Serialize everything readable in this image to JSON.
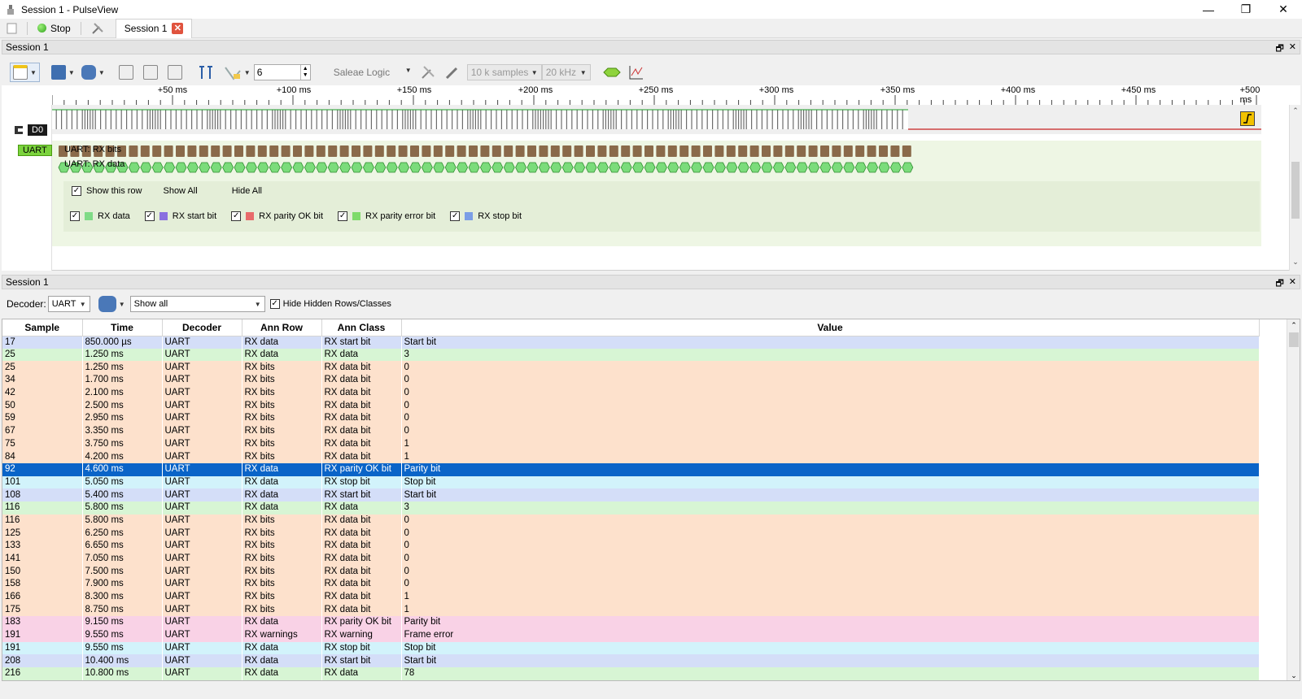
{
  "window": {
    "title": "Session 1 - PulseView",
    "minimize": "—",
    "restore": "❐",
    "close": "✕"
  },
  "tabbar": {
    "stop_label": "Stop",
    "tab_label": "Session 1",
    "tab_close": "✕"
  },
  "panel1": {
    "title": "Session 1",
    "float": "🗗",
    "close": "✕"
  },
  "toolbar1": {
    "samplerate_spin": "6",
    "device": "Saleae Logic",
    "samples": "10 k samples",
    "rate": "20 kHz"
  },
  "ruler": {
    "labels": [
      "+50 ms",
      "+100 ms",
      "+150 ms",
      "+200 ms",
      "+250 ms",
      "+300 ms",
      "+350 ms",
      "+400 ms",
      "+450 ms",
      "+500 ms"
    ]
  },
  "signals": {
    "d0": "D0",
    "uart": "UART",
    "row_bits": "UART: RX bits",
    "row_data": "UART: RX data"
  },
  "row_options": {
    "show_this_row": "Show this row",
    "show_all": "Show All",
    "hide_all": "Hide All",
    "classes": [
      {
        "label": "RX data",
        "color": "#7fdb86"
      },
      {
        "label": "RX start bit",
        "color": "#8a6fe0"
      },
      {
        "label": "RX parity OK bit",
        "color": "#e86b6b"
      },
      {
        "label": "RX parity error bit",
        "color": "#7fdb6a"
      },
      {
        "label": "RX stop bit",
        "color": "#7b9ee6"
      }
    ]
  },
  "panel2": {
    "title": "Session 1",
    "float": "🗗",
    "close": "✕"
  },
  "toolbar2": {
    "decoder_label": "Decoder:",
    "decoder_value": "UART",
    "filter_value": "Show all",
    "hide_hidden_label": "Hide Hidden Rows/Classes"
  },
  "table": {
    "columns": [
      "Sample",
      "Time",
      "Decoder",
      "Ann Row",
      "Ann Class",
      "Value"
    ],
    "rows": [
      [
        "17",
        "850.000 µs",
        "UART",
        "RX data",
        "RX start bit",
        "Start bit"
      ],
      [
        "25",
        "1.250 ms",
        "UART",
        "RX data",
        "RX data",
        "3"
      ],
      [
        "25",
        "1.250 ms",
        "UART",
        "RX bits",
        "RX data bit",
        "0"
      ],
      [
        "34",
        "1.700 ms",
        "UART",
        "RX bits",
        "RX data bit",
        "0"
      ],
      [
        "42",
        "2.100 ms",
        "UART",
        "RX bits",
        "RX data bit",
        "0"
      ],
      [
        "50",
        "2.500 ms",
        "UART",
        "RX bits",
        "RX data bit",
        "0"
      ],
      [
        "59",
        "2.950 ms",
        "UART",
        "RX bits",
        "RX data bit",
        "0"
      ],
      [
        "67",
        "3.350 ms",
        "UART",
        "RX bits",
        "RX data bit",
        "0"
      ],
      [
        "75",
        "3.750 ms",
        "UART",
        "RX bits",
        "RX data bit",
        "1"
      ],
      [
        "84",
        "4.200 ms",
        "UART",
        "RX bits",
        "RX data bit",
        "1"
      ],
      [
        "92",
        "4.600 ms",
        "UART",
        "RX data",
        "RX parity OK bit",
        "Parity bit"
      ],
      [
        "101",
        "5.050 ms",
        "UART",
        "RX data",
        "RX stop bit",
        "Stop bit"
      ],
      [
        "108",
        "5.400 ms",
        "UART",
        "RX data",
        "RX start bit",
        "Start bit"
      ],
      [
        "116",
        "5.800 ms",
        "UART",
        "RX data",
        "RX data",
        "3"
      ],
      [
        "116",
        "5.800 ms",
        "UART",
        "RX bits",
        "RX data bit",
        "0"
      ],
      [
        "125",
        "6.250 ms",
        "UART",
        "RX bits",
        "RX data bit",
        "0"
      ],
      [
        "133",
        "6.650 ms",
        "UART",
        "RX bits",
        "RX data bit",
        "0"
      ],
      [
        "141",
        "7.050 ms",
        "UART",
        "RX bits",
        "RX data bit",
        "0"
      ],
      [
        "150",
        "7.500 ms",
        "UART",
        "RX bits",
        "RX data bit",
        "0"
      ],
      [
        "158",
        "7.900 ms",
        "UART",
        "RX bits",
        "RX data bit",
        "0"
      ],
      [
        "166",
        "8.300 ms",
        "UART",
        "RX bits",
        "RX data bit",
        "1"
      ],
      [
        "175",
        "8.750 ms",
        "UART",
        "RX bits",
        "RX data bit",
        "1"
      ],
      [
        "183",
        "9.150 ms",
        "UART",
        "RX data",
        "RX parity OK bit",
        "Parity bit"
      ],
      [
        "191",
        "9.550 ms",
        "UART",
        "RX warnings",
        "RX warning",
        "Frame error"
      ],
      [
        "191",
        "9.550 ms",
        "UART",
        "RX data",
        "RX stop bit",
        "Stop bit"
      ],
      [
        "208",
        "10.400 ms",
        "UART",
        "RX data",
        "RX start bit",
        "Start bit"
      ],
      [
        "216",
        "10.800 ms",
        "UART",
        "RX data",
        "RX data",
        "78"
      ]
    ],
    "selected_row": 10,
    "row_colors": {
      "RX start bit": "#d4def8",
      "RX data": "#d7f5d4",
      "RX data bit": "#fde1cc",
      "RX parity OK bit": "#f9d2e6",
      "RX stop bit": "#d2f3fb",
      "RX warning": "#f9d2e6"
    }
  }
}
